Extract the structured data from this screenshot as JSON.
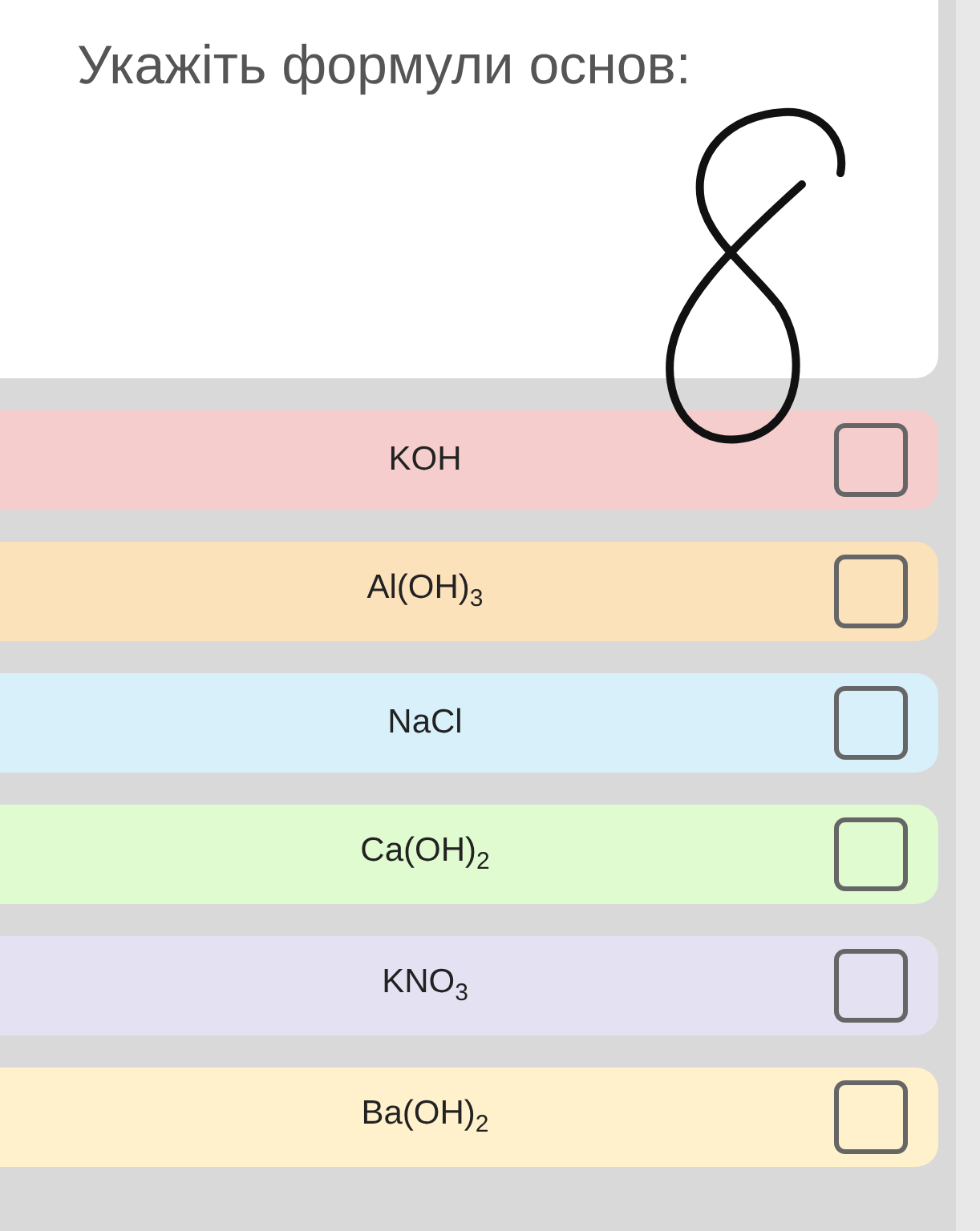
{
  "question": "Укажіть формули основ:",
  "options": [
    {
      "label": "KOH",
      "color": "#f6cdcd",
      "checked": false
    },
    {
      "label": "Al(OH)$_{3}$",
      "color": "#fce2bb",
      "checked": false
    },
    {
      "label": "NaCl",
      "color": "#d8f0fa",
      "checked": false
    },
    {
      "label": "Ca(OH)$_{2}$",
      "color": "#e0fbcf",
      "checked": false
    },
    {
      "label": "KNO$_{3}$",
      "color": "#e4e2f2",
      "checked": false
    },
    {
      "label": "Ba(OH)$_{2}$",
      "color": "#fff1cb",
      "checked": false
    }
  ]
}
